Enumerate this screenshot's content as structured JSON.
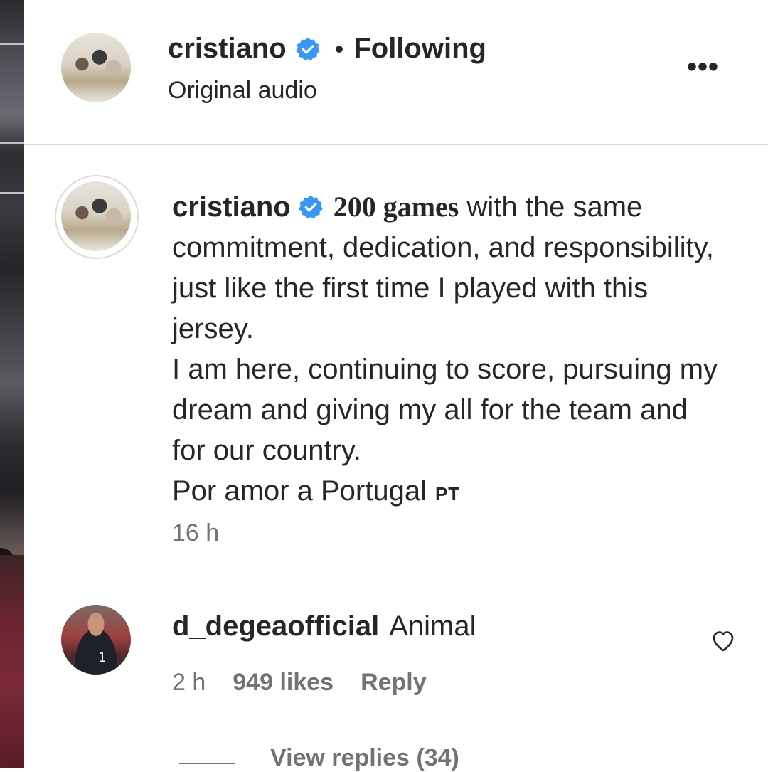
{
  "header": {
    "username": "cristiano",
    "separator": "•",
    "follow_status": "Following",
    "audio": "Original audio",
    "more_icon": "more-horizontal-icon"
  },
  "caption": {
    "username": "cristiano",
    "bold_text": "200 games",
    "text_1": "with the same commitment, dedication, and responsibility, just like the first time I played with this jersey.",
    "text_2": "I am here, continuing to score, pursuing my dream and giving my all for the team and for our country.",
    "text_3": "Por amor a Portugal",
    "flag": "PT",
    "time": "16 h"
  },
  "comment": {
    "username": "d_degeaofficial",
    "text": "Animal",
    "time": "2 h",
    "likes": "949 likes",
    "reply": "Reply",
    "view_replies": "View replies (34)",
    "avatar_number": "1"
  },
  "colors": {
    "verified": "#3897f0",
    "text": "#262626",
    "secondary": "#737373",
    "divider": "#dbdbdb"
  }
}
